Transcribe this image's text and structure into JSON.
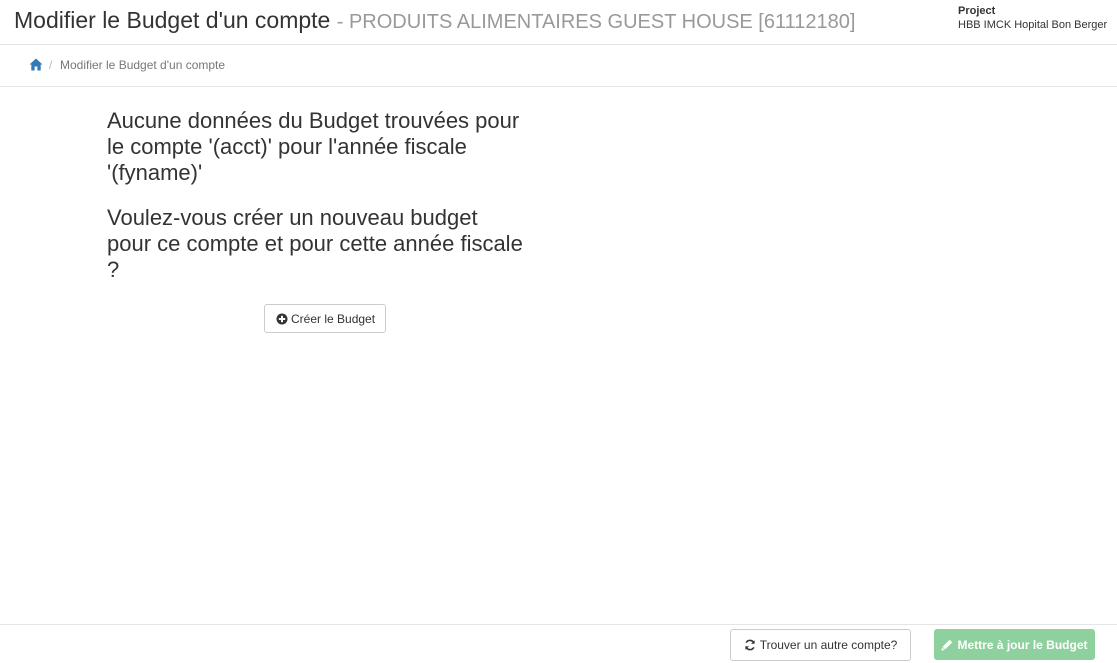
{
  "header": {
    "title": "Modifier le Budget d'un compte",
    "subtitle": "- PRODUITS ALIMENTAIRES GUEST HOUSE [61112180]",
    "project_label": "Project",
    "project_name": "HBB IMCK Hopital Bon Berger"
  },
  "breadcrumb": {
    "separator": "/",
    "current": "Modifier le Budget d'un compte"
  },
  "main": {
    "no_data_message": "Aucune données du Budget trouvées pour le compte '(acct)' pour l'année fiscale '(fyname)'",
    "create_prompt": "Voulez-vous créer un nouveau budget pour ce compte et pour cette année fiscale ?",
    "create_button_label": "Créer le Budget"
  },
  "footer": {
    "find_button_label": "Trouver un autre compte?",
    "update_button_label": "Mettre à jour le Budget"
  },
  "icons": {
    "home": "home-icon",
    "plus_circle": "plus-circle-icon",
    "refresh": "refresh-icon",
    "pencil": "pencil-icon"
  },
  "colors": {
    "link": "#337ab7",
    "success_disabled": "#8fd19e",
    "muted": "#999999"
  }
}
